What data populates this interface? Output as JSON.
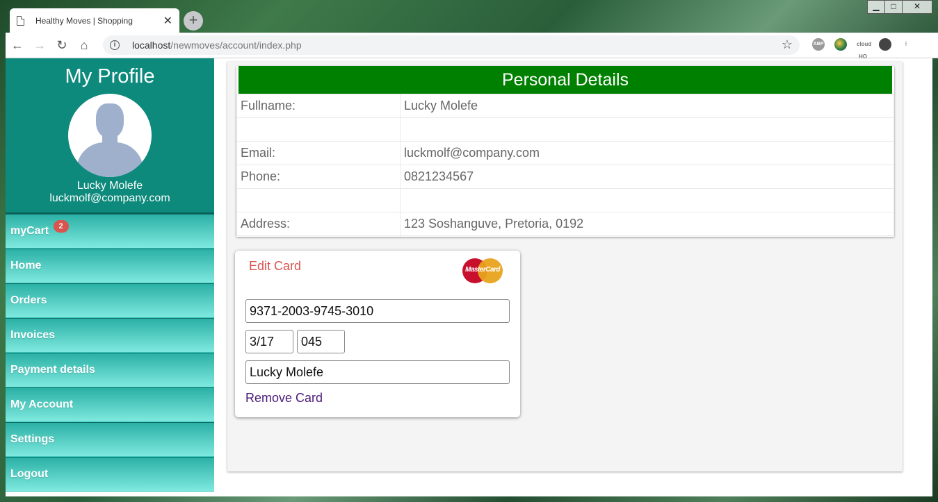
{
  "browser": {
    "tab_title": "Healthy Moves | Shopping",
    "url_host": "localhost",
    "url_path": "/newmoves/account/index.php",
    "ext_abp": "ABP",
    "ext_hq": "cloud HQ"
  },
  "sidebar": {
    "title": "My Profile",
    "user_name": "Lucky Molefe",
    "user_email": "luckmolf@company.com",
    "items": [
      {
        "label": "myCart",
        "badge": "2"
      },
      {
        "label": "Home"
      },
      {
        "label": "Orders"
      },
      {
        "label": "Invoices"
      },
      {
        "label": "Payment details"
      },
      {
        "label": "My Account"
      },
      {
        "label": "Settings"
      },
      {
        "label": "Logout"
      }
    ]
  },
  "details": {
    "heading": "Personal Details",
    "rows": [
      {
        "label": "Fullname:",
        "value": "Lucky Molefe"
      },
      {
        "label": "",
        "value": ""
      },
      {
        "label": "Email:",
        "value": "luckmolf@company.com"
      },
      {
        "label": "Phone:",
        "value": "0821234567"
      },
      {
        "label": "",
        "value": ""
      },
      {
        "label": "Address:",
        "value": "123 Soshanguve, Pretoria, 0192"
      }
    ]
  },
  "card": {
    "edit_label": "Edit Card",
    "brand": "MasterCard",
    "number": "9371-2003-9745-3010",
    "expiry": "3/17",
    "cvv": "045",
    "holder": "Lucky Molefe",
    "remove_label": "Remove Card"
  },
  "colors": {
    "sidebar_header": "#0d8a7c",
    "details_header": "#008000",
    "edit_card": "#d9534f",
    "badge": "#d9534f"
  }
}
